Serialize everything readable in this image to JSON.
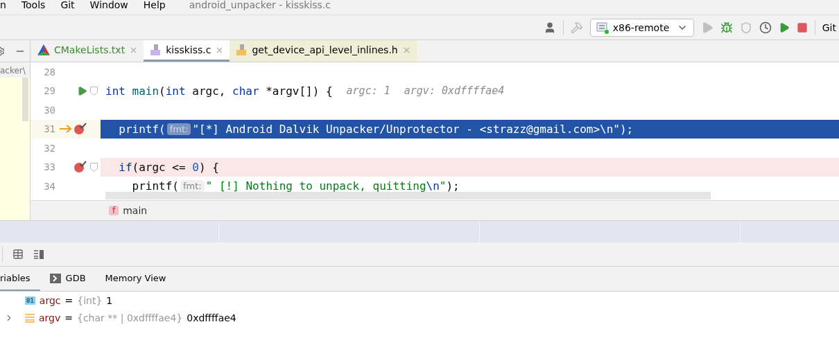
{
  "menu": [
    "n",
    "Tools",
    "Git",
    "Window",
    "Help"
  ],
  "window": {
    "title": "android_unpacker - kisskiss.c"
  },
  "run_config": {
    "label": "x86-remote"
  },
  "toolbar_end": "Git",
  "project_panel": {
    "path": "acker\\"
  },
  "tabs": [
    {
      "label": "CMakeLists.txt",
      "kind": "cmake",
      "color": "#3a8a2e",
      "selected": false
    },
    {
      "label": "kisskiss.c",
      "kind": "c",
      "color": "#000000",
      "selected": true
    },
    {
      "label": "get_device_api_level_inlines.h",
      "kind": "h",
      "color": "#000000",
      "selected": false
    }
  ],
  "code_lines": [
    {
      "number": "28",
      "run_marker": false,
      "execution_point": false,
      "breakpoint": false,
      "fold": false
    },
    {
      "number": "29",
      "run_marker": true,
      "execution_point": false,
      "breakpoint": false,
      "fold": true,
      "tokens": [
        {
          "kind": "keyword",
          "text": "int"
        },
        {
          "kind": "function",
          "text": " main"
        },
        {
          "kind": "plain",
          "text": "("
        },
        {
          "kind": "keyword",
          "text": "int"
        },
        {
          "kind": "plain",
          "text": " argc, "
        },
        {
          "kind": "keyword",
          "text": "char"
        },
        {
          "kind": "plain",
          "text": " *argv[]) {"
        },
        {
          "kind": "inline_value",
          "text": "argc: 1"
        },
        {
          "kind": "inline_value",
          "text": "argv: 0xdffffae4"
        }
      ]
    },
    {
      "number": "30",
      "run_marker": false,
      "execution_point": false,
      "breakpoint": false,
      "fold": false
    },
    {
      "number": "31",
      "run_marker": false,
      "execution_point": true,
      "breakpoint": true,
      "fold": false,
      "tokens": [
        {
          "kind": "plain",
          "text": "  printf("
        },
        {
          "kind": "param_hint",
          "text": "fmt:"
        },
        {
          "kind": "string",
          "text": "\"[*] Android Dalvik Unpacker/Unprotector - <strazz@gmail.com>\\n\""
        },
        {
          "kind": "plain",
          "text": ");"
        }
      ]
    },
    {
      "number": "32",
      "run_marker": false,
      "execution_point": false,
      "breakpoint": false,
      "fold": false
    },
    {
      "number": "33",
      "run_marker": false,
      "execution_point": false,
      "breakpoint": true,
      "fold": true,
      "tokens": [
        {
          "kind": "keyword",
          "text": "  if"
        },
        {
          "kind": "plain",
          "text": "(argc <= "
        },
        {
          "kind": "number",
          "text": "0"
        },
        {
          "kind": "plain",
          "text": ") {"
        }
      ]
    },
    {
      "number": "34",
      "run_marker": false,
      "execution_point": false,
      "breakpoint": false,
      "fold": false,
      "tokens": [
        {
          "kind": "plain",
          "text": "    printf("
        },
        {
          "kind": "param_hint",
          "text": "fmt:"
        },
        {
          "kind": "string",
          "text": "\" [!] Nothing to unpack, quitting"
        },
        {
          "kind": "escape",
          "text": "\\n"
        },
        {
          "kind": "string",
          "text": "\""
        },
        {
          "kind": "plain",
          "text": ");"
        }
      ]
    }
  ],
  "breadcrumb": {
    "badge": "f",
    "label": "main"
  },
  "debug_tabs": [
    {
      "label": "riables",
      "kind": "plain",
      "selected": true
    },
    {
      "label": "GDB",
      "kind": "console",
      "selected": false
    },
    {
      "label": "Memory View",
      "kind": "plain",
      "selected": false
    }
  ],
  "variables": [
    {
      "kind": "primitive",
      "badge": "01",
      "name": "argc",
      "separator": "=",
      "type": "{int}",
      "value": "1",
      "expandable": false
    },
    {
      "kind": "array",
      "name": "argv",
      "separator": "=",
      "type": "{char ** | 0xdffffae4}",
      "value": "0xdffffae4",
      "expandable": true
    }
  ]
}
